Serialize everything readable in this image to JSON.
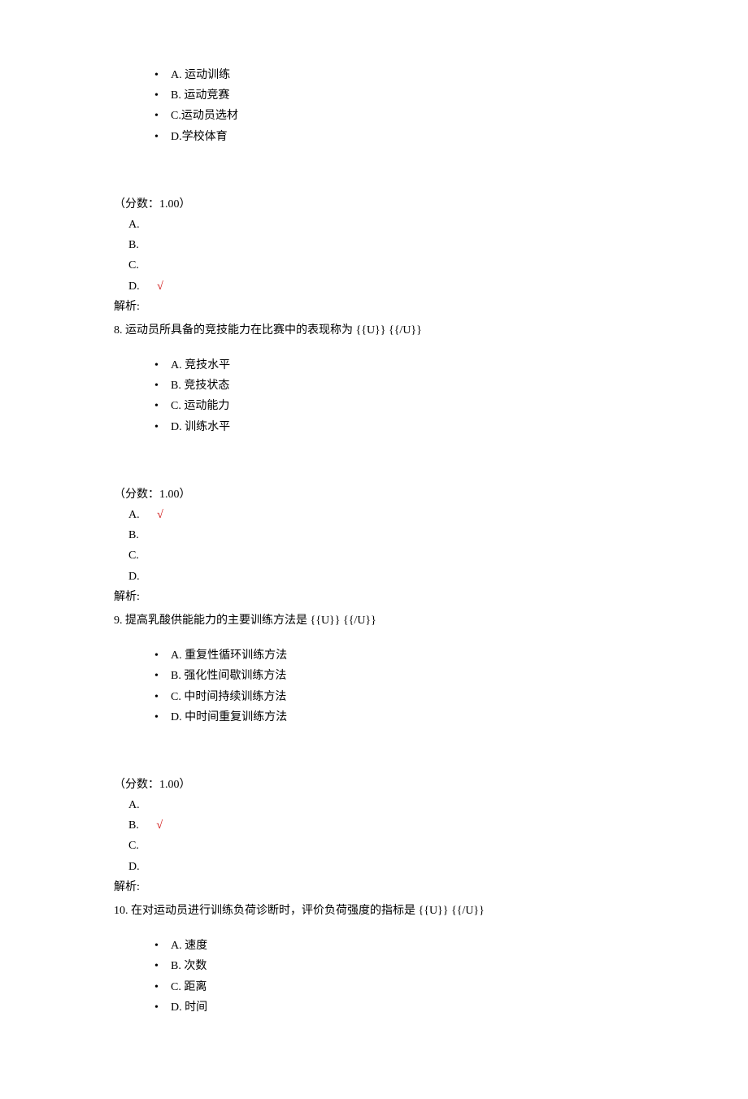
{
  "q7": {
    "options": [
      "A. 运动训练",
      "B. 运动竞赛",
      "C.运动员选材",
      "D.学校体育"
    ],
    "score": "（分数：1.00）",
    "answers": {
      "a": "A.",
      "b": "B.",
      "c": "C.",
      "d": "D.",
      "correct": "√"
    },
    "analysis": "解析:"
  },
  "q8": {
    "stem": "8. 运动员所具备的竞技能力在比赛中的表现称为 {{U}} {{/U}}",
    "options": [
      "A. 竞技水平",
      "B. 竞技状态",
      "C. 运动能力",
      "D. 训练水平"
    ],
    "score": "（分数：1.00）",
    "answers": {
      "a": "A.",
      "b": "B.",
      "c": "C.",
      "d": "D.",
      "correct": "√"
    },
    "analysis": "解析:"
  },
  "q9": {
    "stem": "9. 提高乳酸供能能力的主要训练方法是 {{U}} {{/U}}",
    "options": [
      "A. 重复性循环训练方法",
      "B. 强化性间歇训练方法",
      "C. 中时间持续训练方法",
      "D. 中时间重复训练方法"
    ],
    "score": "（分数：1.00）",
    "answers": {
      "a": "A.",
      "b": "B.",
      "c": "C.",
      "d": "D.",
      "correct": "√"
    },
    "analysis": "解析:"
  },
  "q10": {
    "stem": "10. 在对运动员进行训练负荷诊断时，评价负荷强度的指标是 {{U}} {{/U}}",
    "options": [
      "A. 速度",
      "B. 次数",
      "C. 距离",
      "D. 时间"
    ]
  }
}
